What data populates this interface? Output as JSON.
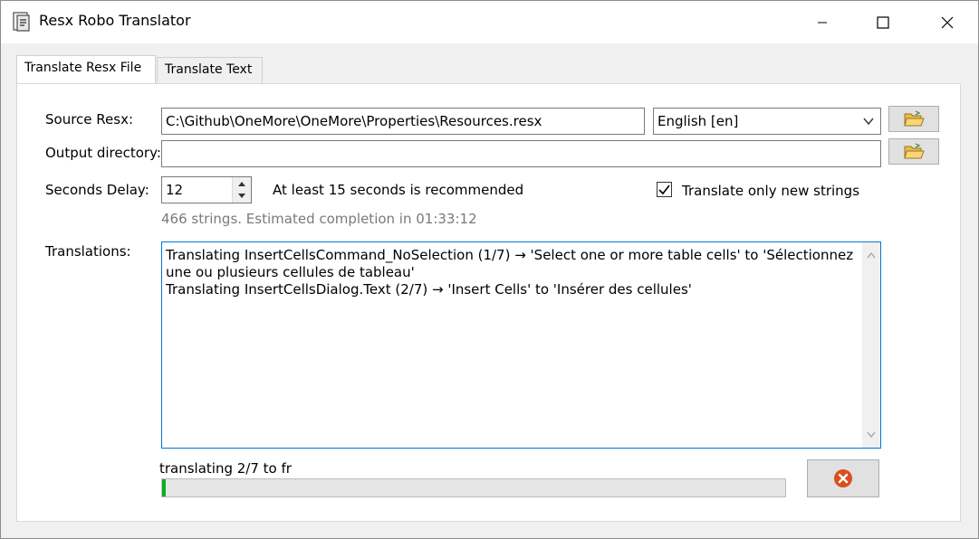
{
  "window": {
    "title": "Resx Robo Translator",
    "icon": "document-icon"
  },
  "titlebar_buttons": [
    "minimize-icon",
    "maximize-icon",
    "close-icon"
  ],
  "tabs": [
    {
      "label": "Translate Resx File",
      "active": true
    },
    {
      "label": "Translate Text",
      "active": false
    }
  ],
  "form": {
    "source_label": "Source Resx:",
    "source_value": "C:\\Github\\OneMore\\OneMore\\Properties\\Resources.resx",
    "language_value": "English [en]",
    "output_label": "Output directory:",
    "output_value": "",
    "delay_label": "Seconds Delay:",
    "delay_value": "12",
    "delay_hint": "At least 15 seconds is recommended",
    "only_new_label": "Translate only new strings",
    "only_new_checked": true,
    "estimate_text": "466 strings. Estimated completion in 01:33:12",
    "translations_label": "Translations:",
    "translations_lines": [
      "Translating InsertCellsCommand_NoSelection (1/7) → 'Select one or more table cells' to 'Sélectionnez une ou plusieurs cellules de tableau'",
      "Translating InsertCellsDialog.Text (2/7) → 'Insert Cells' to 'Insérer des cellules'"
    ]
  },
  "progress": {
    "status_text": "translating 2/7 to fr",
    "fraction": 0.006
  },
  "buttons": {
    "browse_icon": "folder-open-icon",
    "cancel_icon": "cancel-x-icon"
  },
  "colors": {
    "progress_fill": "#06b025",
    "cancel": "#d9501e",
    "focus_border": "#0078d7"
  }
}
